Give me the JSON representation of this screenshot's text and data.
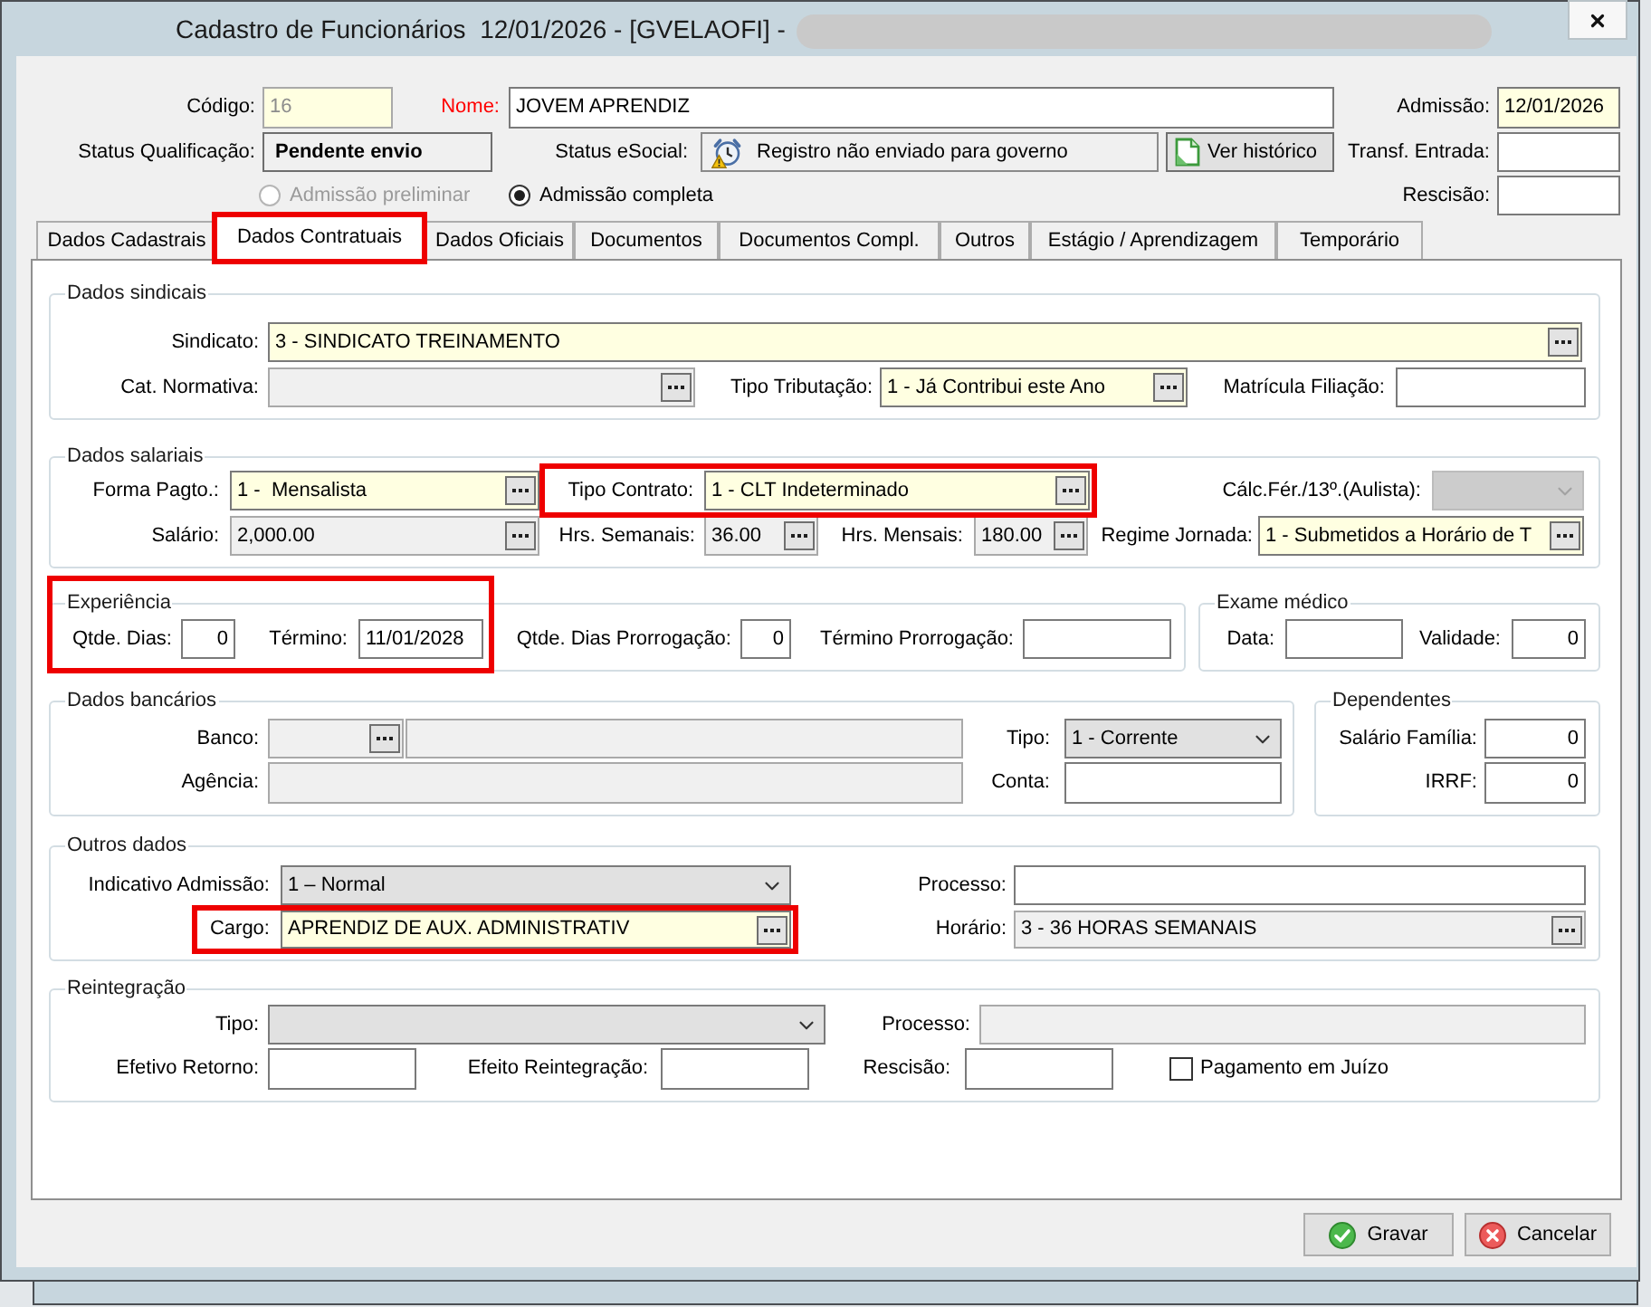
{
  "window": {
    "title": "Cadastro de Funcionários  12/01/2026 - [GVELAOFI] -"
  },
  "header": {
    "fields": [
      {
        "kind": "text",
        "label": "Código:",
        "value": "16",
        "required": true,
        "readonly": true
      },
      {
        "kind": "text",
        "label": "Nome:",
        "value": "JOVEM APRENDIZ",
        "required": false,
        "readonly": false,
        "label_alert": true
      },
      {
        "kind": "text",
        "label": "Admissão:",
        "value": "12/01/2026",
        "required": true,
        "readonly": false
      },
      {
        "kind": "status",
        "label": "Status Qualificação:",
        "value": "Pendente envio"
      },
      {
        "kind": "alert_status",
        "label": "Status eSocial:",
        "value": "Registro não enviado para governo"
      },
      {
        "kind": "button",
        "label": "Ver histórico"
      },
      {
        "kind": "text",
        "label": "Transf. Entrada:",
        "required": false,
        "readonly": false
      },
      {
        "kind": "radio",
        "label": "Admissão preliminar",
        "selected": false,
        "disabled": true
      },
      {
        "kind": "radio",
        "label": "Admissão completa",
        "selected": true,
        "disabled": false
      },
      {
        "kind": "text",
        "label": "Rescisão:",
        "required": false,
        "readonly": false
      }
    ]
  },
  "tabs": [
    {
      "label": "Dados Cadastrais",
      "selected": false,
      "highlighted": false
    },
    {
      "label": "Dados Contratuais",
      "selected": true,
      "highlighted": true
    },
    {
      "label": "Dados Oficiais",
      "selected": false,
      "highlighted": false
    },
    {
      "label": "Documentos",
      "selected": false,
      "highlighted": false
    },
    {
      "label": "Documentos Compl.",
      "selected": false,
      "highlighted": false
    },
    {
      "label": "Outros",
      "selected": false,
      "highlighted": false
    },
    {
      "label": "Estágio / Aprendizagem",
      "selected": false,
      "highlighted": false
    },
    {
      "label": "Temporário",
      "selected": false,
      "highlighted": false
    }
  ],
  "groups": [
    {
      "title": "Dados sindicais",
      "highlighted": false,
      "fields": [
        {
          "kind": "lookup",
          "label": "Sindicato:",
          "value": "3 - SINDICATO TREINAMENTO",
          "required": true,
          "readonly": false
        },
        {
          "kind": "lookup",
          "label": "Cat. Normativa:",
          "required": false,
          "readonly": true
        },
        {
          "kind": "lookup",
          "label": "Tipo Tributação:",
          "value": "1 - Já Contribui este Ano",
          "required": true,
          "readonly": false
        },
        {
          "kind": "text",
          "label": "Matrícula Filiação:",
          "required": false,
          "readonly": false
        }
      ]
    },
    {
      "title": "Dados salariais",
      "highlighted": false,
      "fields": [
        {
          "kind": "lookup",
          "label": "Forma Pagto.:",
          "value": "1 -  Mensalista",
          "required": true,
          "readonly": false
        },
        {
          "kind": "lookup",
          "label": "Tipo Contrato:",
          "value": "1 - CLT Indeterminado",
          "required": true,
          "readonly": false,
          "highlighted": true
        },
        {
          "kind": "select",
          "label": "Cálc.Fér./13º.(Aulista):",
          "disabled": true
        },
        {
          "kind": "lookup",
          "label": "Salário:",
          "value": "2,000.00",
          "required": false,
          "readonly": true
        },
        {
          "kind": "lookup",
          "label": "Hrs. Semanais:",
          "value": "36.00",
          "required": false,
          "readonly": true
        },
        {
          "kind": "lookup",
          "label": "Hrs. Mensais:",
          "value": "180.00",
          "required": false,
          "readonly": true
        },
        {
          "kind": "lookup",
          "label": "Regime Jornada:",
          "value": "1 - Submetidos a Horário de T",
          "required": true,
          "readonly": false
        }
      ]
    },
    {
      "title": "Experiência",
      "highlighted": true,
      "fields": [
        {
          "kind": "text",
          "label": "Qtde. Dias:",
          "value": "0",
          "required": false,
          "readonly": false
        },
        {
          "kind": "text",
          "label": "Término:",
          "value": "11/01/2028",
          "required": false,
          "readonly": false
        },
        {
          "kind": "text",
          "label": "Qtde. Dias Prorrogação:",
          "value": "0",
          "required": false,
          "readonly": false
        },
        {
          "kind": "text",
          "label": "Término Prorrogação:",
          "required": false,
          "readonly": false
        }
      ]
    },
    {
      "title": "Exame médico",
      "highlighted": false,
      "fields": [
        {
          "kind": "text",
          "label": "Data:",
          "required": false,
          "readonly": false
        },
        {
          "kind": "text",
          "label": "Validade:",
          "value": "0",
          "required": false,
          "readonly": false
        }
      ]
    },
    {
      "title": "Dados bancários",
      "highlighted": false,
      "fields": [
        {
          "kind": "lookup",
          "label": "Banco:",
          "required": false,
          "readonly": true
        },
        {
          "kind": "text",
          "required": false,
          "readonly": true
        },
        {
          "kind": "select",
          "label": "Tipo:",
          "value": "1 - Corrente",
          "disabled": false
        },
        {
          "kind": "text",
          "label": "Agência:",
          "required": false,
          "readonly": true
        },
        {
          "kind": "text",
          "label": "Conta:",
          "required": false,
          "readonly": false
        }
      ]
    },
    {
      "title": "Dependentes",
      "highlighted": false,
      "fields": [
        {
          "kind": "text",
          "label": "Salário Família:",
          "value": "0",
          "required": false,
          "readonly": false
        },
        {
          "kind": "text",
          "label": "IRRF:",
          "value": "0",
          "required": false,
          "readonly": false
        }
      ]
    },
    {
      "title": "Outros dados",
      "highlighted": false,
      "fields": [
        {
          "kind": "select",
          "label": "Indicativo Admissão:",
          "value": "1 – Normal",
          "disabled": false
        },
        {
          "kind": "text",
          "label": "Processo:",
          "required": false,
          "readonly": false
        },
        {
          "kind": "lookup",
          "label": "Cargo:",
          "value": "APRENDIZ DE AUX. ADMINISTRATIV",
          "required": true,
          "readonly": false,
          "highlighted": true
        },
        {
          "kind": "lookup",
          "label": "Horário:",
          "value": "3 - 36 HORAS SEMANAIS",
          "required": false,
          "readonly": true
        }
      ]
    },
    {
      "title": "Reintegração",
      "highlighted": false,
      "fields": [
        {
          "kind": "select",
          "label": "Tipo:",
          "disabled": false
        },
        {
          "kind": "text",
          "label": "Processo:",
          "required": false,
          "readonly": true
        },
        {
          "kind": "text",
          "label": "Efetivo Retorno:",
          "required": false,
          "readonly": false
        },
        {
          "kind": "text",
          "label": "Efeito Reintegração:",
          "required": false,
          "readonly": false
        },
        {
          "kind": "text",
          "label": "Rescisão:",
          "required": false,
          "readonly": false
        },
        {
          "kind": "checkbox",
          "label": "Pagamento em Juízo",
          "checked": false
        }
      ]
    }
  ],
  "buttons": [
    {
      "kind": "save",
      "label": "Gravar"
    },
    {
      "kind": "cancel",
      "label": "Cancelar"
    }
  ]
}
